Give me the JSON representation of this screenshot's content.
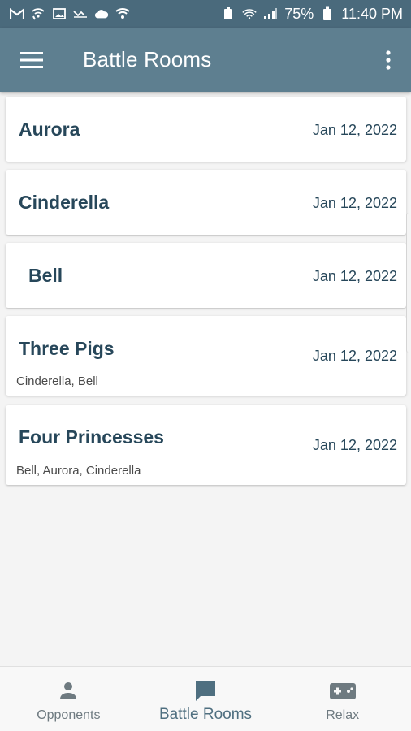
{
  "status_bar": {
    "battery": "75%",
    "time": "11:40 PM",
    "icons": [
      "gmail-icon",
      "wifi-call-icon",
      "gallery-icon",
      "missed-call-icon",
      "cloud-icon",
      "shield-icon",
      "battery-saver-icon",
      "wifi-icon",
      "signal-icon",
      "battery-icon"
    ]
  },
  "app_bar": {
    "title": "Battle Rooms",
    "menu_icon": "hamburger-menu-icon",
    "more_icon": "more-vert-icon"
  },
  "rooms": [
    {
      "name": "Aurora",
      "date": "Jan 12, 2022",
      "members": ""
    },
    {
      "name": "Cinderella",
      "date": "Jan 12, 2022",
      "members": ""
    },
    {
      "name": "Bell",
      "date": "Jan 12, 2022",
      "members": ""
    },
    {
      "name": "Three Pigs",
      "date": "Jan 12, 2022",
      "members": "Cinderella, Bell"
    },
    {
      "name": "Four Princesses",
      "date": "Jan 12, 2022",
      "members": "Bell, Aurora, Cinderella"
    }
  ],
  "bottom_nav": {
    "items": [
      {
        "label": "Opponents",
        "icon": "person-icon"
      },
      {
        "label": "Battle Rooms",
        "icon": "chat-bubble-icon"
      },
      {
        "label": "Relax",
        "icon": "gamepad-icon"
      }
    ],
    "active": "Battle Rooms"
  },
  "colors": {
    "status_bar": "#4a6a7c",
    "app_bar": "#5e7f90",
    "title_text": "#27475a",
    "background": "#f4f4f4"
  }
}
